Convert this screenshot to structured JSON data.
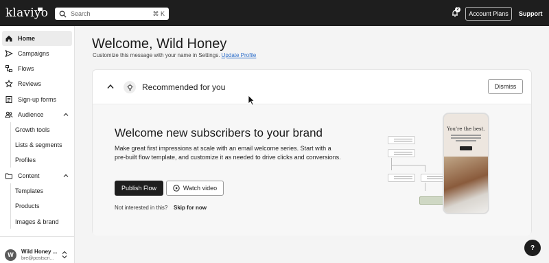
{
  "brand": {
    "logo_text": "klaviyo"
  },
  "search": {
    "placeholder": "Search",
    "shortcut": "⌘ K"
  },
  "header": {
    "notification_count": "2",
    "account_plans": "Account Plans",
    "support": "Support"
  },
  "sidebar": {
    "items": [
      {
        "label": "Home",
        "icon": "home-icon",
        "active": true
      },
      {
        "label": "Campaigns",
        "icon": "send-icon"
      },
      {
        "label": "Flows",
        "icon": "flows-icon"
      },
      {
        "label": "Reviews",
        "icon": "star-icon"
      },
      {
        "label": "Sign-up forms",
        "icon": "form-icon"
      },
      {
        "label": "Audience",
        "icon": "people-icon",
        "expanded": true
      },
      {
        "label": "Content",
        "icon": "folder-icon",
        "expanded": true
      }
    ],
    "audience_sub": [
      "Growth tools",
      "Lists & segments",
      "Profiles"
    ],
    "content_sub": [
      "Templates",
      "Products",
      "Images & brand"
    ]
  },
  "account": {
    "initial": "W",
    "name": "Wild Honey ...",
    "email": "bre@postscri..."
  },
  "main": {
    "title": "Welcome, Wild Honey",
    "subtitle": "Customize this message with your name in Settings.",
    "update_profile": "Update Profile"
  },
  "recommend": {
    "title": "Recommended for you",
    "dismiss": "Dismiss",
    "hero_title": "Welcome new subscribers to your brand",
    "hero_desc": "Make great first impressions at scale with an email welcome series. Start with a pre-built flow template, and customize it as needed to drive clicks and conversions.",
    "publish": "Publish Flow",
    "watch": "Watch video",
    "not_interested": "Not interested in this?",
    "skip": "Skip for now",
    "phone_title": "You're the best."
  },
  "help": {
    "label": "?"
  },
  "colors": {
    "topbar": "#1e1e1e",
    "link": "#2c6ecb",
    "primary_button": "#1e1e1e"
  }
}
